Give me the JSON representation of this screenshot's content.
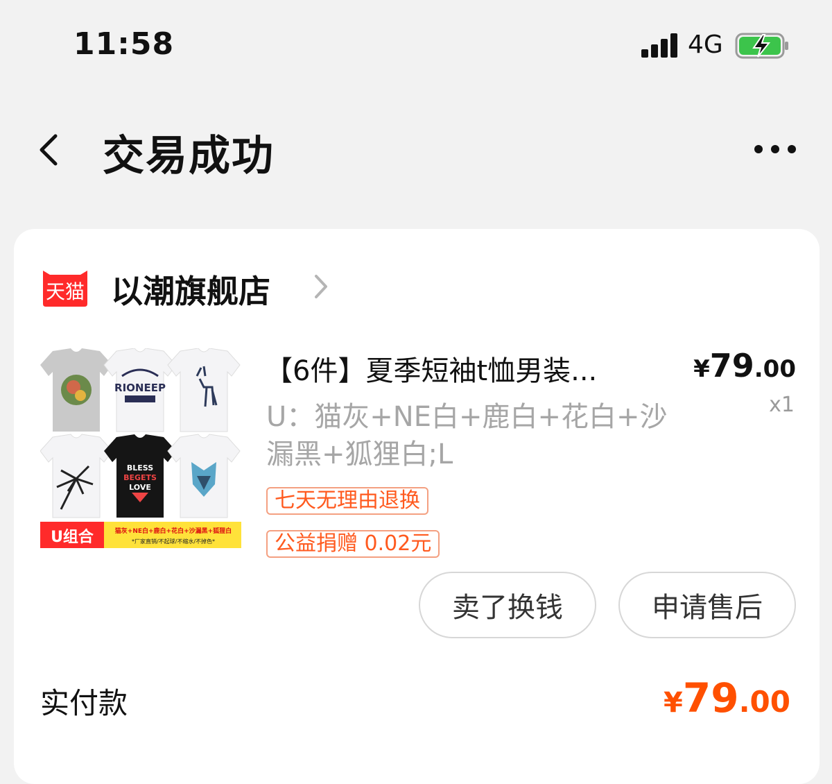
{
  "status_bar": {
    "time": "11:58",
    "network": "4G"
  },
  "nav": {
    "title": "交易成功"
  },
  "shop": {
    "badge_text": "天猫",
    "name": "以潮旗舰店"
  },
  "product": {
    "title": "【6件】夏季短袖t恤男装...",
    "price_currency": "¥",
    "price_int": "79",
    "price_dec": ".00",
    "quantity": "x1",
    "sku": "U：猫灰+NE白+鹿白+花白+沙漏黑+狐狸白;L",
    "tags": [
      "七天无理由退换",
      "公益捐赠 0.02元"
    ],
    "image_banner_left": "U组合",
    "image_banner_line1": "猫灰+NE白+鹿白+花白+沙漏黑+狐狸白",
    "image_banner_line2": "*厂家直销/不起球/不缩水/不掉色*",
    "shirt_prints": [
      "RIONEEP",
      "BLESS",
      "BEGETS",
      "LOVE"
    ]
  },
  "actions": {
    "sell_label": "卖了换钱",
    "after_sale_label": "申请售后"
  },
  "payment": {
    "label": "实付款",
    "currency": "¥",
    "int": "79",
    "dec": ".00"
  },
  "colors": {
    "accent": "#ff5000",
    "tmall_red": "#ff2a2a",
    "tag_border": "#f4a081"
  }
}
